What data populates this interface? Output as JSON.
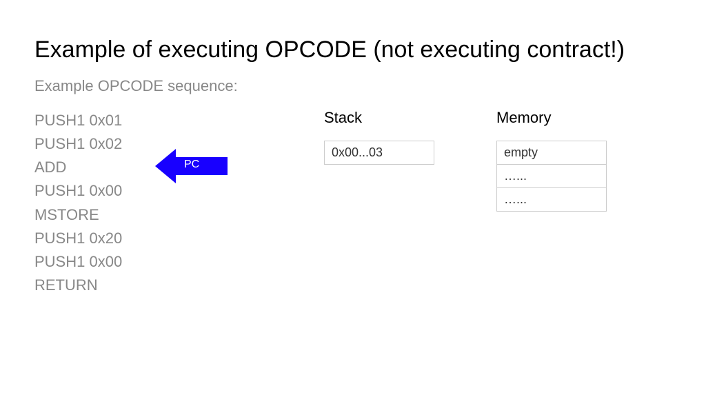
{
  "title": "Example of executing OPCODE (not executing contract!)",
  "subtitle": "Example OPCODE sequence:",
  "opcodes": [
    "PUSH1 0x01",
    "PUSH1 0x02",
    "ADD",
    "PUSH1 0x00",
    "MSTORE",
    "PUSH1 0x20",
    "PUSH1 0x00",
    "RETURN"
  ],
  "pc_label": "PC",
  "pc_color": "#1800ff",
  "stack": {
    "header": "Stack",
    "items": [
      "0x00...03"
    ]
  },
  "memory": {
    "header": "Memory",
    "items": [
      "empty",
      "…...",
      "…..."
    ]
  }
}
